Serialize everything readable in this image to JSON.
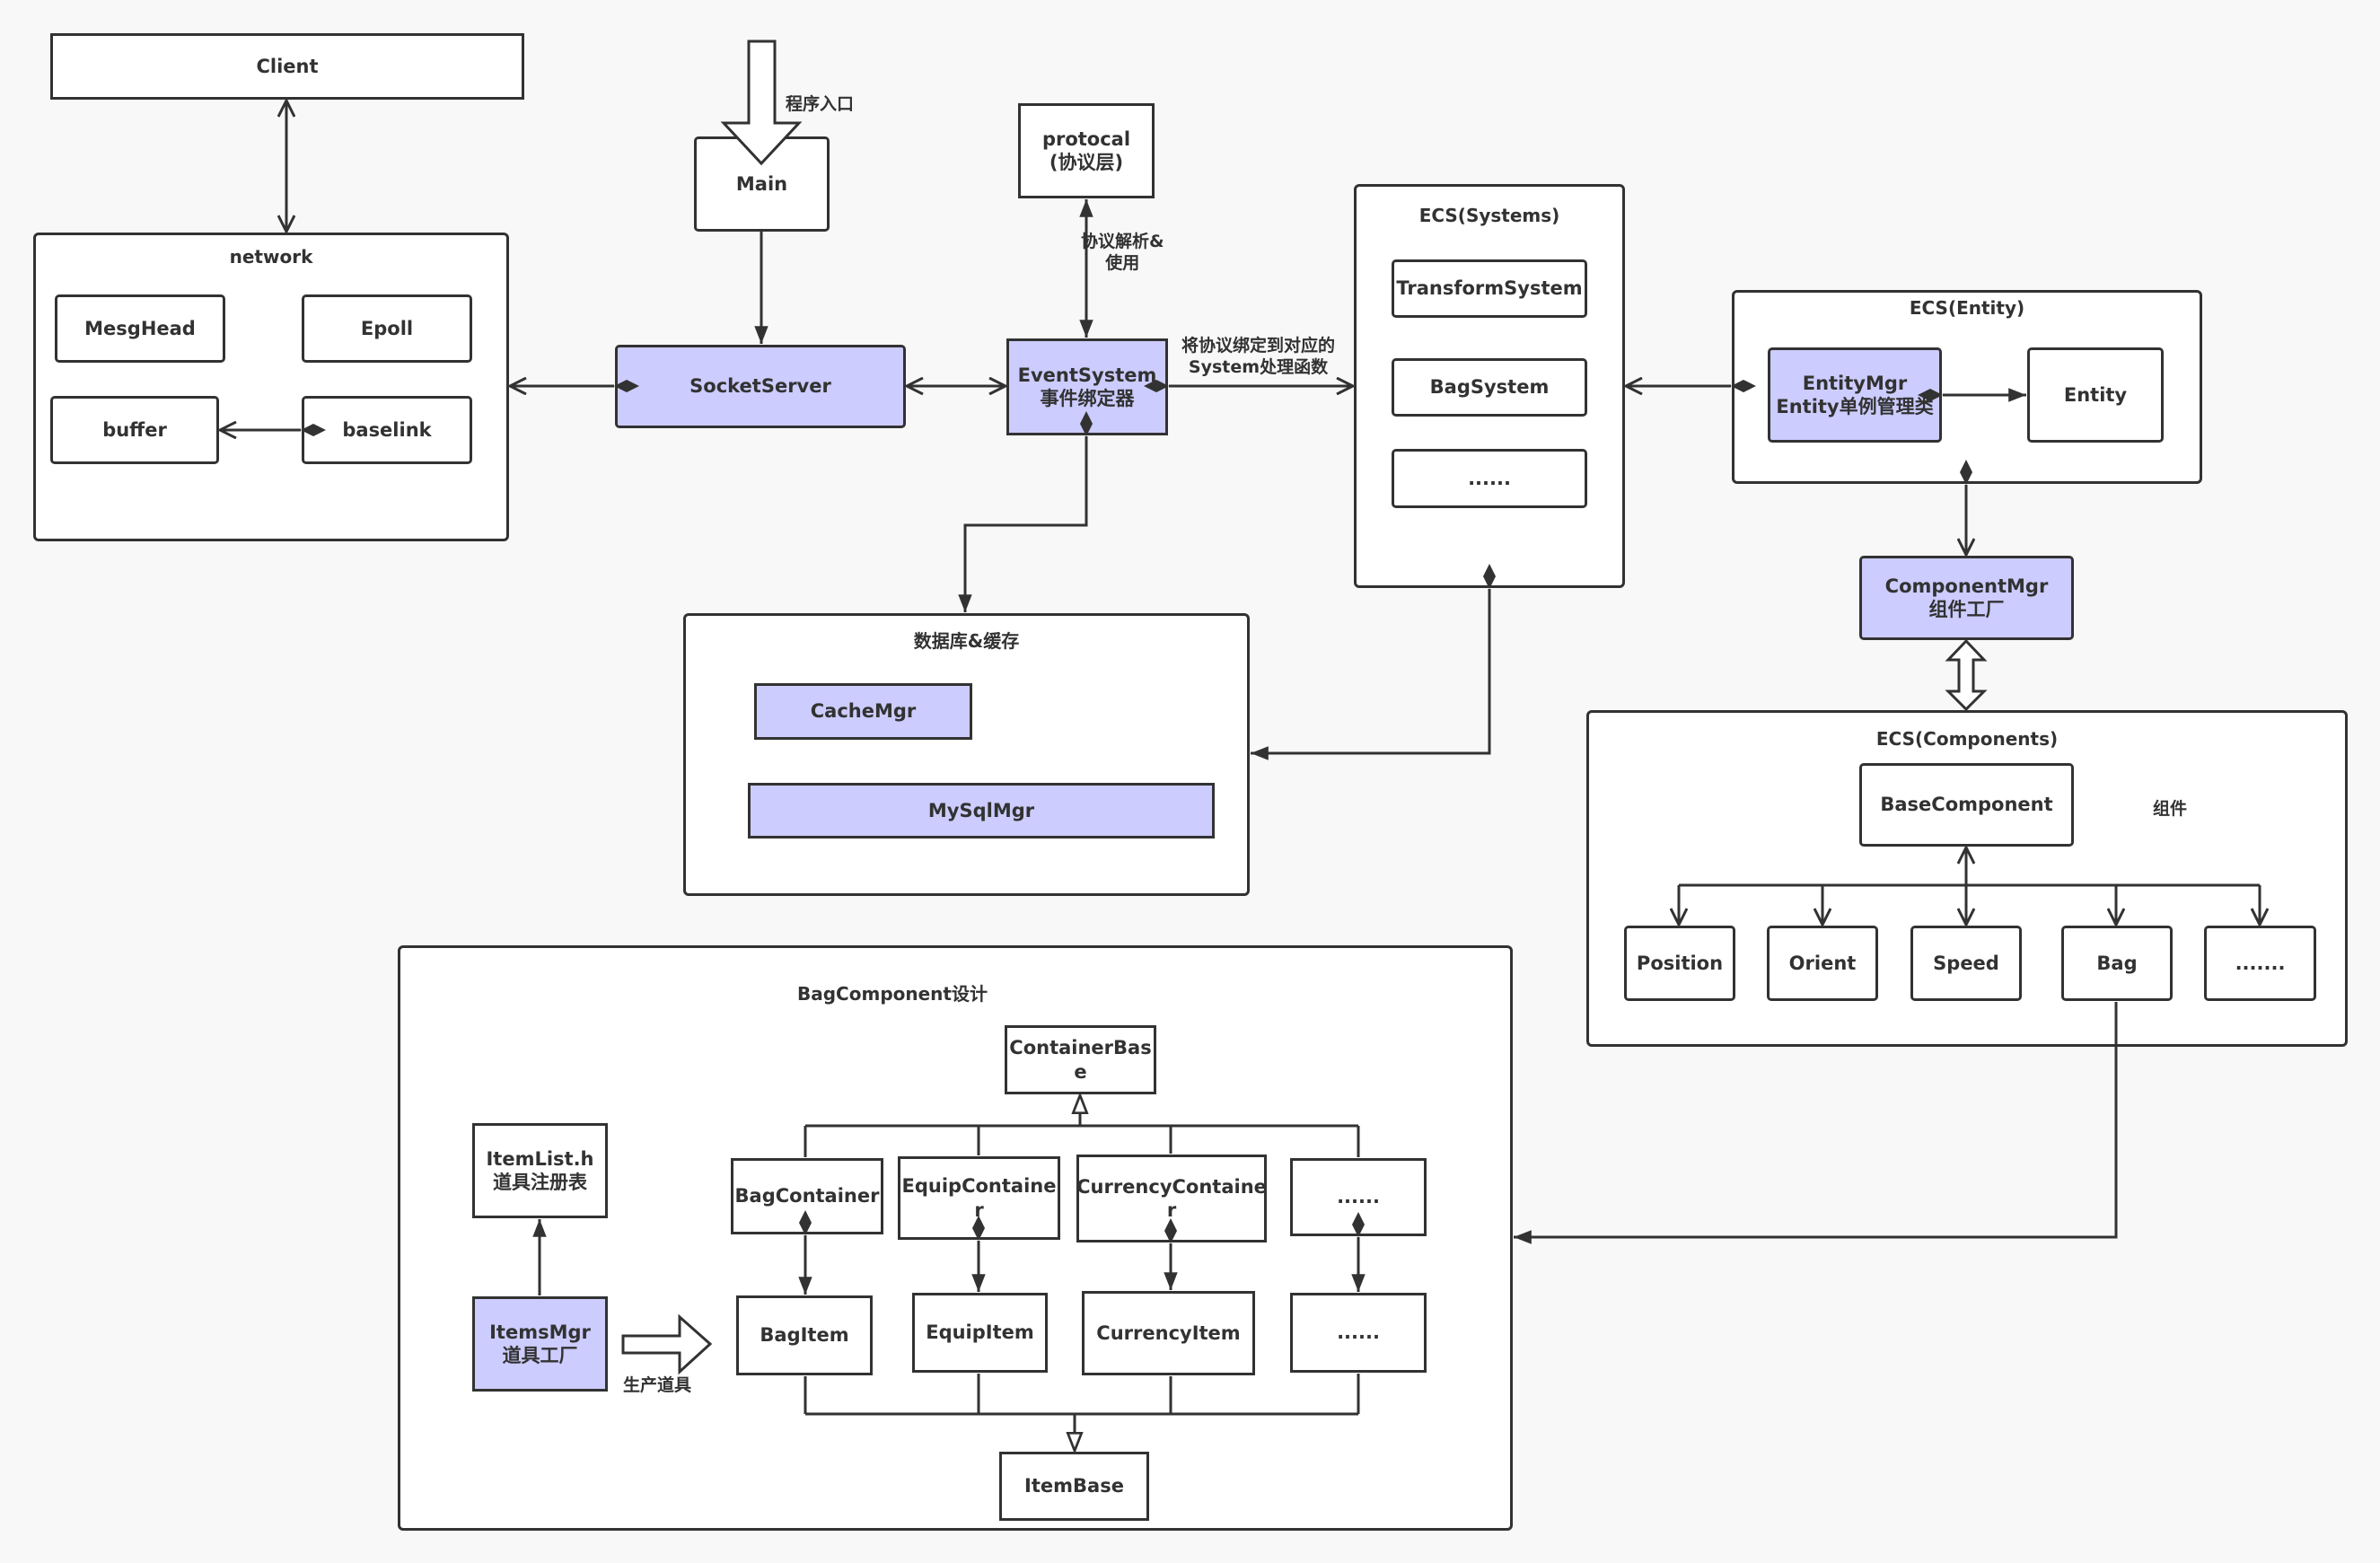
{
  "client": "Client",
  "network": {
    "title": "network",
    "mesghead": "MesgHead",
    "epoll": "Epoll",
    "buffer": "buffer",
    "baselink": "baselink"
  },
  "main": {
    "label": "Main",
    "entry_label": "程序入口"
  },
  "socket_server": "SocketServer",
  "protocal": "protocal\n(协议层)",
  "protocol_edge_label": "协议解析&\n使用",
  "event_system": "EventSystem\n事件绑定器",
  "bind_edge_label": "将协议绑定到对应的\nSystem处理函数",
  "systems": {
    "title": "ECS(Systems)",
    "items": [
      "TransformSystem",
      "BagSystem",
      "......"
    ]
  },
  "entity": {
    "title": "ECS(Entity)",
    "mgr": "EntityMgr\nEntity单例管理类",
    "entity": "Entity"
  },
  "component_mgr": "ComponentMgr\n组件工厂",
  "components": {
    "title": "ECS(Components)",
    "base": "BaseComponent",
    "side_label": "组件",
    "items": [
      "Position",
      "Orient",
      "Speed",
      "Bag",
      "......."
    ]
  },
  "database": {
    "title": "数据库&缓存",
    "cache": "CacheMgr",
    "mysql": "MySqlMgr"
  },
  "bag_component": {
    "title": "BagComponent设计",
    "container_base": "ContainerBas\ne",
    "containers": [
      "BagContainer",
      "EquipContaine\nr",
      "CurrencyContaine\nr",
      "......"
    ],
    "items": [
      "BagItem",
      "EquipItem",
      "CurrencyItem",
      "......"
    ],
    "item_base": "ItemBase",
    "item_list": "ItemList.h\n道具注册表",
    "items_mgr": "ItemsMgr\n道具工厂",
    "produce_label": "生产道具"
  },
  "colors": {
    "highlight": "#ccccff",
    "stroke": "#323232",
    "background": "#f8f8f8"
  }
}
